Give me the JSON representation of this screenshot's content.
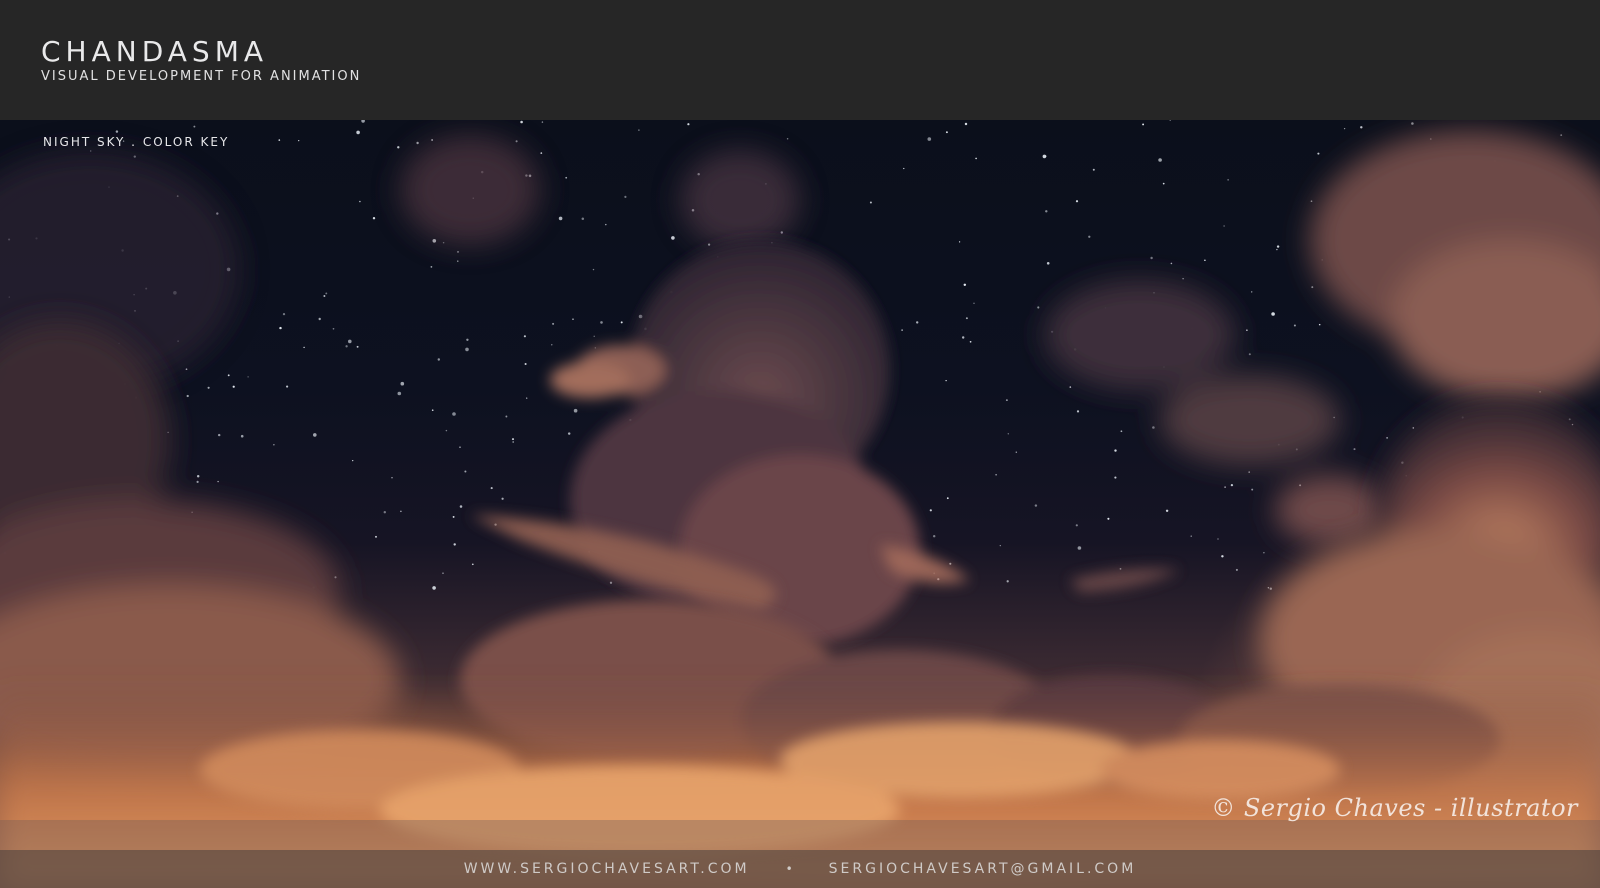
{
  "header": {
    "title": "CHANDASMA",
    "subtitle": "VISUAL DEVELOPMENT FOR ANIMATION"
  },
  "painting": {
    "caption": "NIGHT SKY . COLOR KEY",
    "signature": "© Sergio Chaves - illustrator"
  },
  "footer": {
    "website": "WWW.SERGIOCHAVESART.COM",
    "separator": "•",
    "email": "SERGIOCHAVESART@GMAIL.COM"
  },
  "colors": {
    "header_bg": "#262626",
    "sky_dark": "#0b0f1b",
    "cloud_glow": "#d98a5a"
  }
}
